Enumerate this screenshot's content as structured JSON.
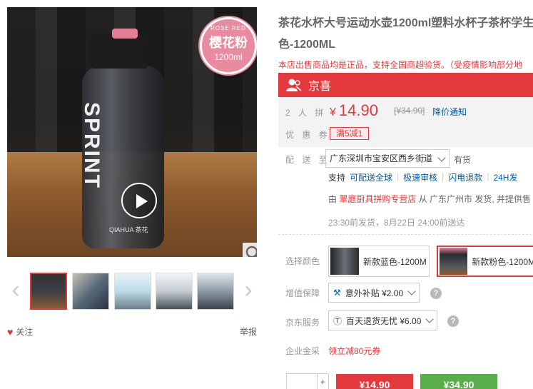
{
  "gallery": {
    "badge": {
      "top": "ROSE RED",
      "main": "樱花粉",
      "size": "1200ml"
    },
    "bottle_brand": "SPRINT",
    "bottle_sub": "QIAHUA 茶花",
    "thumbs": [
      "thumb-1",
      "thumb-2",
      "thumb-3",
      "thumb-4",
      "thumb-5"
    ]
  },
  "follow_label": "关注",
  "report_label": "举报",
  "product": {
    "title": "茶花水杯大号运动水壶1200ml塑料水杯子茶杯学生色-1200ML",
    "notice": "本店出售商品均是正品，支持全国商超验货。（受疫情影响部分地"
  },
  "jingxi": {
    "label": "京喜"
  },
  "price": {
    "group_label": "2 人 拼",
    "currency": "¥",
    "value": "14.90",
    "original": "[¥34.90]",
    "notify": "降价通知",
    "coupon_label": "优 惠 券",
    "coupon": "满5减1"
  },
  "delivery": {
    "label": "配 送 至",
    "address": "广东深圳市宝安区西乡街道",
    "stock": "有货",
    "support_label": "支持",
    "support_items": [
      "可配送全球",
      "极速审核",
      "闪电退款",
      "24H发"
    ],
    "seller_prefix": "由",
    "store": "翠庭厨具拼购专营店",
    "seller_suffix": "从 广东广州市 发货, 并提供售",
    "ship_time": "23:30前发货，8月22日 24:00前送达"
  },
  "options": {
    "color_label": "选择颜色",
    "colors": [
      "新款蓝色-1200M",
      "新款粉色-1200M"
    ],
    "vas_label": "增值保障",
    "vas_value": "意外补贴 ¥2.00",
    "jd_service_label": "京东服务",
    "jd_service_value": "百天退货无忧 ¥6.00",
    "gold_label": "企业金采",
    "gold_value": "领立减80元券"
  },
  "buy": {
    "qty_plus": "+",
    "group_price": "¥14.90",
    "single_price": "¥34.90"
  },
  "colors": {
    "accent": "#e4393c",
    "link": "#005ea7",
    "buy_red": "#e4393c",
    "buy_green": "#59ad4a"
  }
}
